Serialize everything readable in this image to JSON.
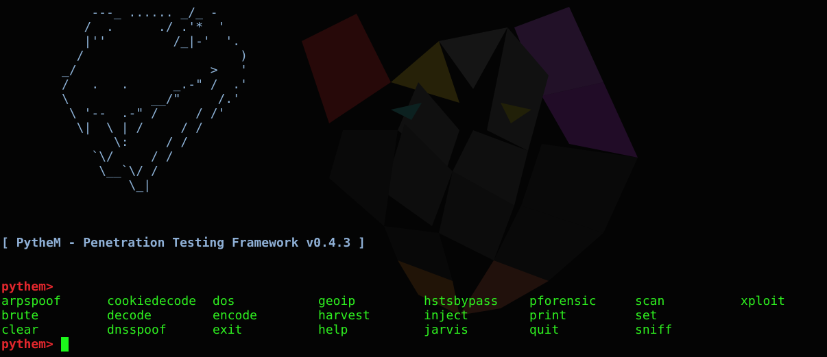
{
  "terminal": {
    "banner_ascii": "    ---_ ...... _/_ -\n   /  .      ./ .'*  '\n   |''         /_|-'  '.\n  /                     )\n_/                  >   '\n/   .   .      _.-\" /  .'\n\\           __/\"     /.'\n \\ '--  .-\" /     / /'\n  \\|  \\ | /     / /\n       \\:     / /\n    `\\/     / /\n     \\__`\\/ /\n         \\_|",
    "title": "[ PytheM - Penetration Testing Framework v0.4.3 ]",
    "prompt_label": "pythem>",
    "commands": [
      [
        "arpspoof",
        "cookiedecode",
        "dos",
        "geoip",
        "hstsbypass",
        "pforensic",
        "scan",
        "xploit"
      ],
      [
        "brute",
        "decode",
        "encode",
        "harvest",
        "inject",
        "print",
        "set",
        ""
      ],
      [
        "clear",
        "dnsspoof",
        "exit",
        "help",
        "jarvis",
        "quit",
        "sniff",
        ""
      ]
    ],
    "wallpaper_icon": "wolf-icon",
    "colors": {
      "background": "#040404",
      "banner": "#8eb3d8",
      "title": "#8fb0d6",
      "prompt": "#e2272d",
      "commands": "#2ef01f",
      "cursor": "#1cf81b"
    }
  }
}
